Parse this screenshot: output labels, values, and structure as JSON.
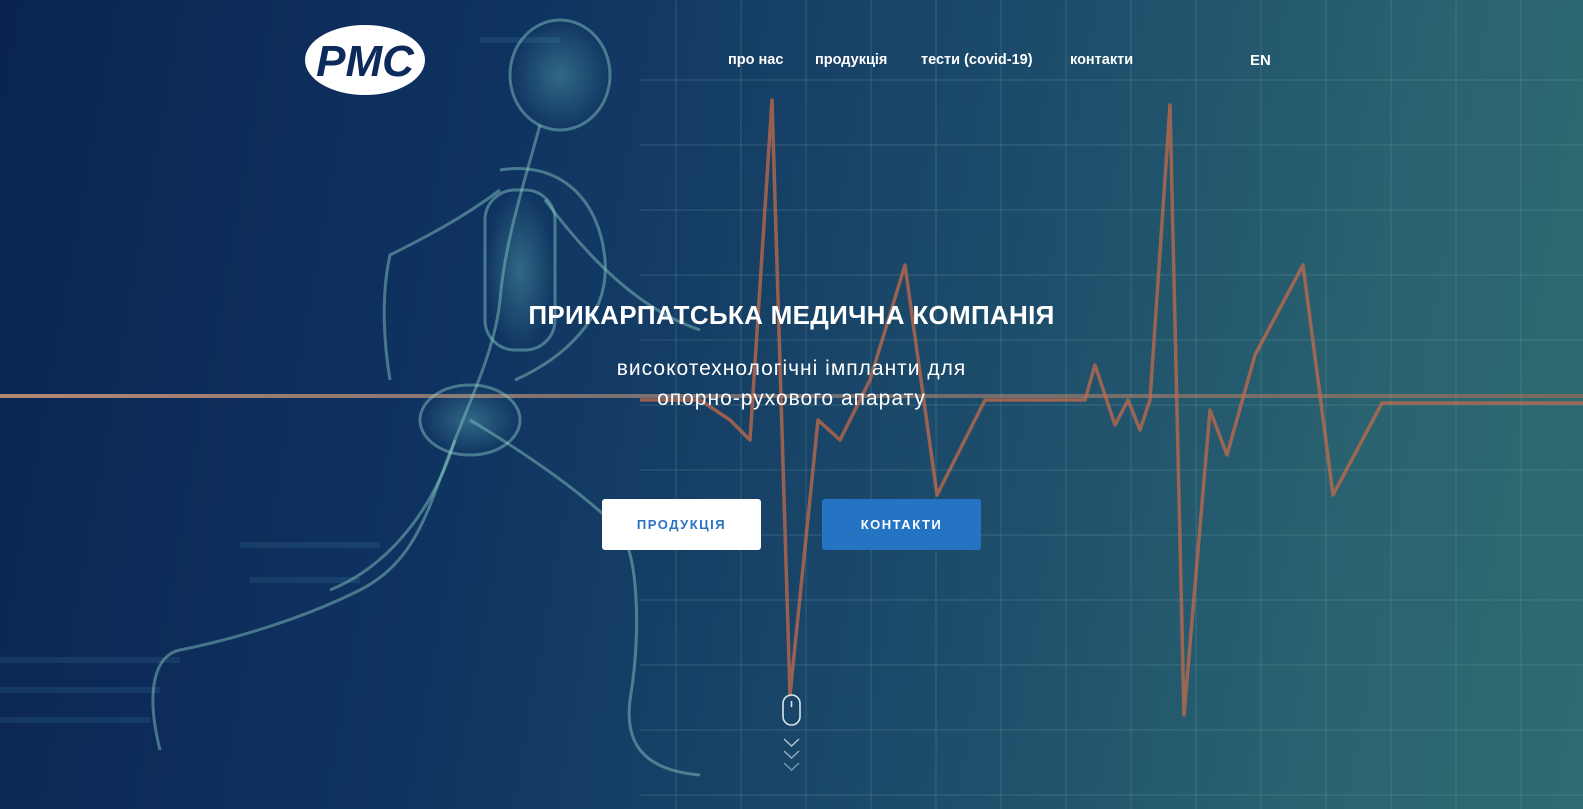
{
  "brand": {
    "logo_text": "PMC",
    "logo_bg_color": "#ffffff",
    "logo_text_color": "#0d2a5c"
  },
  "nav": {
    "items": [
      {
        "label": "про нас"
      },
      {
        "label": "продукція"
      },
      {
        "label": "тести (covid-19)"
      },
      {
        "label": "контакти"
      }
    ],
    "language": "EN"
  },
  "hero": {
    "title": "ПРИКАРПАТСЬКА МЕДИЧНА КОМПАНІЯ",
    "subtitle_line1": "високотехнологічні імпланти для",
    "subtitle_line2": "опорно-рухового апарату",
    "buttons": {
      "products_label": "ПРОДУКЦІЯ",
      "contacts_label": "КОНТАКТИ"
    },
    "scroll_icon": "mouse-scroll-icon"
  },
  "colors": {
    "bg_dark": "#0a2352",
    "bg_light": "#2d6b71",
    "accent_blue": "#2474c3",
    "ecg_line": "#c46a4a"
  }
}
